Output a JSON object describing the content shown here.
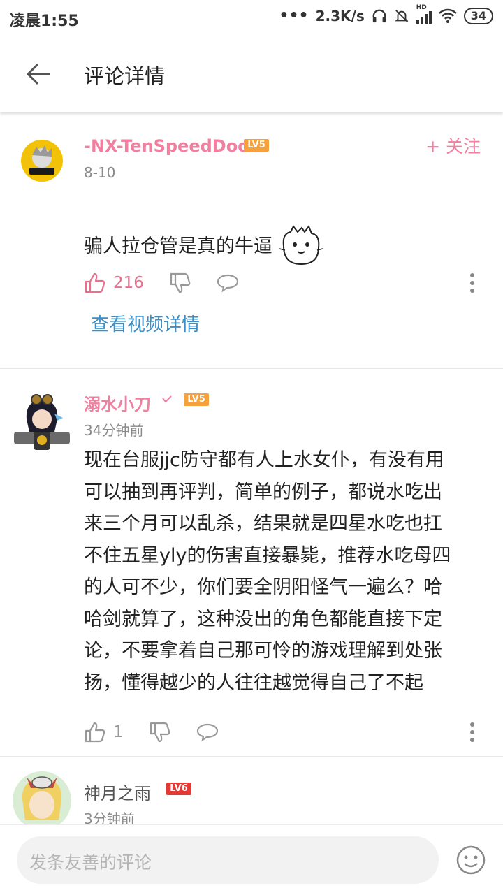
{
  "status_bar": {
    "time": "凌晨1:55",
    "network_speed": "2.3K/s",
    "hd_label": "HD",
    "battery": "34"
  },
  "header": {
    "title": "评论详情"
  },
  "main_comment": {
    "username": "-NX-TenSpeedDoc",
    "level": "LV5",
    "date": "8-10",
    "follow_label": "+ 关注",
    "text": "骗人拉仓管是真的牛逼",
    "likes": "216",
    "view_video_label": "查看视频详情"
  },
  "replies": [
    {
      "username": "溺水小刀",
      "level": "LV5",
      "time": "34分钟前",
      "text_lines": [
        "现在台服jjc防守都有人上水女仆，有没有用",
        "可以抽到再评判，简单的例子，都说水吃出",
        "来三个月可以乱杀，结果就是四星水吃也扛",
        "不住五星yly的伤害直接暴毙，推荐水吃母四",
        "的人可不少，你们要全阴阳怪气一遍么？哈",
        "哈剑就算了，这种没出的角色都能直接下定",
        "论，不要拿着自己那可怜的游戏理解到处张",
        "扬，懂得越少的人往往越觉得自己了不起"
      ],
      "likes": "1"
    },
    {
      "username": "神月之雨",
      "level": "LV6",
      "time": "3分钟前"
    }
  ],
  "comment_input": {
    "placeholder": "发条友善的评论"
  },
  "colors": {
    "accent_pink": "#f07fa0",
    "link_blue": "#3a8fc7",
    "level_orange": "#f6a13b",
    "level_red": "#e53935"
  }
}
